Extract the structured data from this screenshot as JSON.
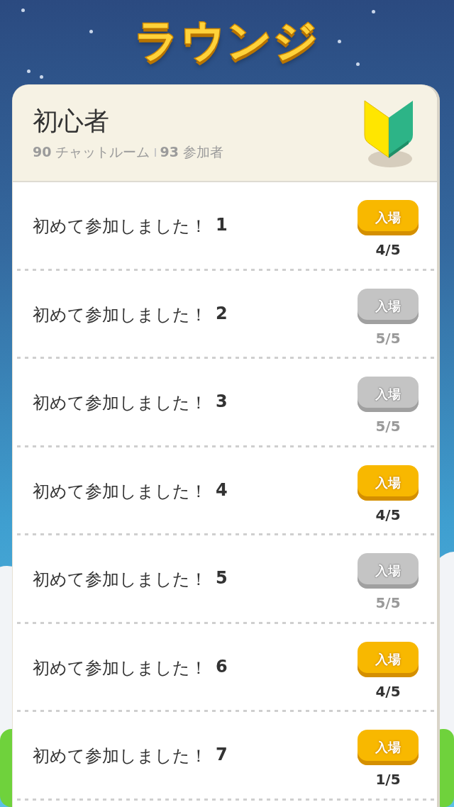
{
  "title": "ラウンジ",
  "lounge": {
    "name": "初心者",
    "room_count": "**90** チャットルーム",
    "participant_count": "**93** 参加者"
  },
  "rooms": [
    {
      "title": "初めて参加しました！",
      "number": "1",
      "button": "入場",
      "disabled": false,
      "count": "4/5"
    },
    {
      "title": "初めて参加しました！",
      "number": "2",
      "button": "入場",
      "disabled": true,
      "count": "5/5"
    },
    {
      "title": "初めて参加しました！",
      "number": "3",
      "button": "入場",
      "disabled": true,
      "count": "5/5"
    },
    {
      "title": "初めて参加しました！",
      "number": "4",
      "button": "入場",
      "disabled": false,
      "count": "4/5"
    },
    {
      "title": "初めて参加しました！",
      "number": "5",
      "button": "入場",
      "disabled": true,
      "count": "5/5"
    },
    {
      "title": "初めて参加しました！",
      "number": "6",
      "button": "入場",
      "disabled": false,
      "count": "4/5"
    },
    {
      "title": "初めて参加しました！",
      "number": "7",
      "button": "入場",
      "disabled": false,
      "count": "1/5"
    }
  ]
}
